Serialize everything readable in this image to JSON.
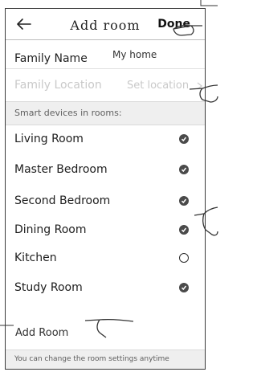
{
  "header": {
    "title": "Add room",
    "done_label": "Done"
  },
  "family": {
    "name_label": "Family Name",
    "name_value": "My home",
    "location_label": "Family Location",
    "location_value": "Set location"
  },
  "rooms_section": {
    "title": "Smart devices in rooms:",
    "items": [
      {
        "name": "Living Room",
        "selected": true
      },
      {
        "name": "Master Bedroom",
        "selected": true
      },
      {
        "name": "Second Bedroom",
        "selected": true
      },
      {
        "name": "Dining Room",
        "selected": true
      },
      {
        "name": "Kitchen",
        "selected": false
      },
      {
        "name": "Study Room",
        "selected": true
      }
    ]
  },
  "add_room_label": "Add Room",
  "footer_note": "You can change the room settings anytime",
  "colors": {
    "check_fill": "#4a4a4a",
    "section_bg": "#efefef"
  }
}
